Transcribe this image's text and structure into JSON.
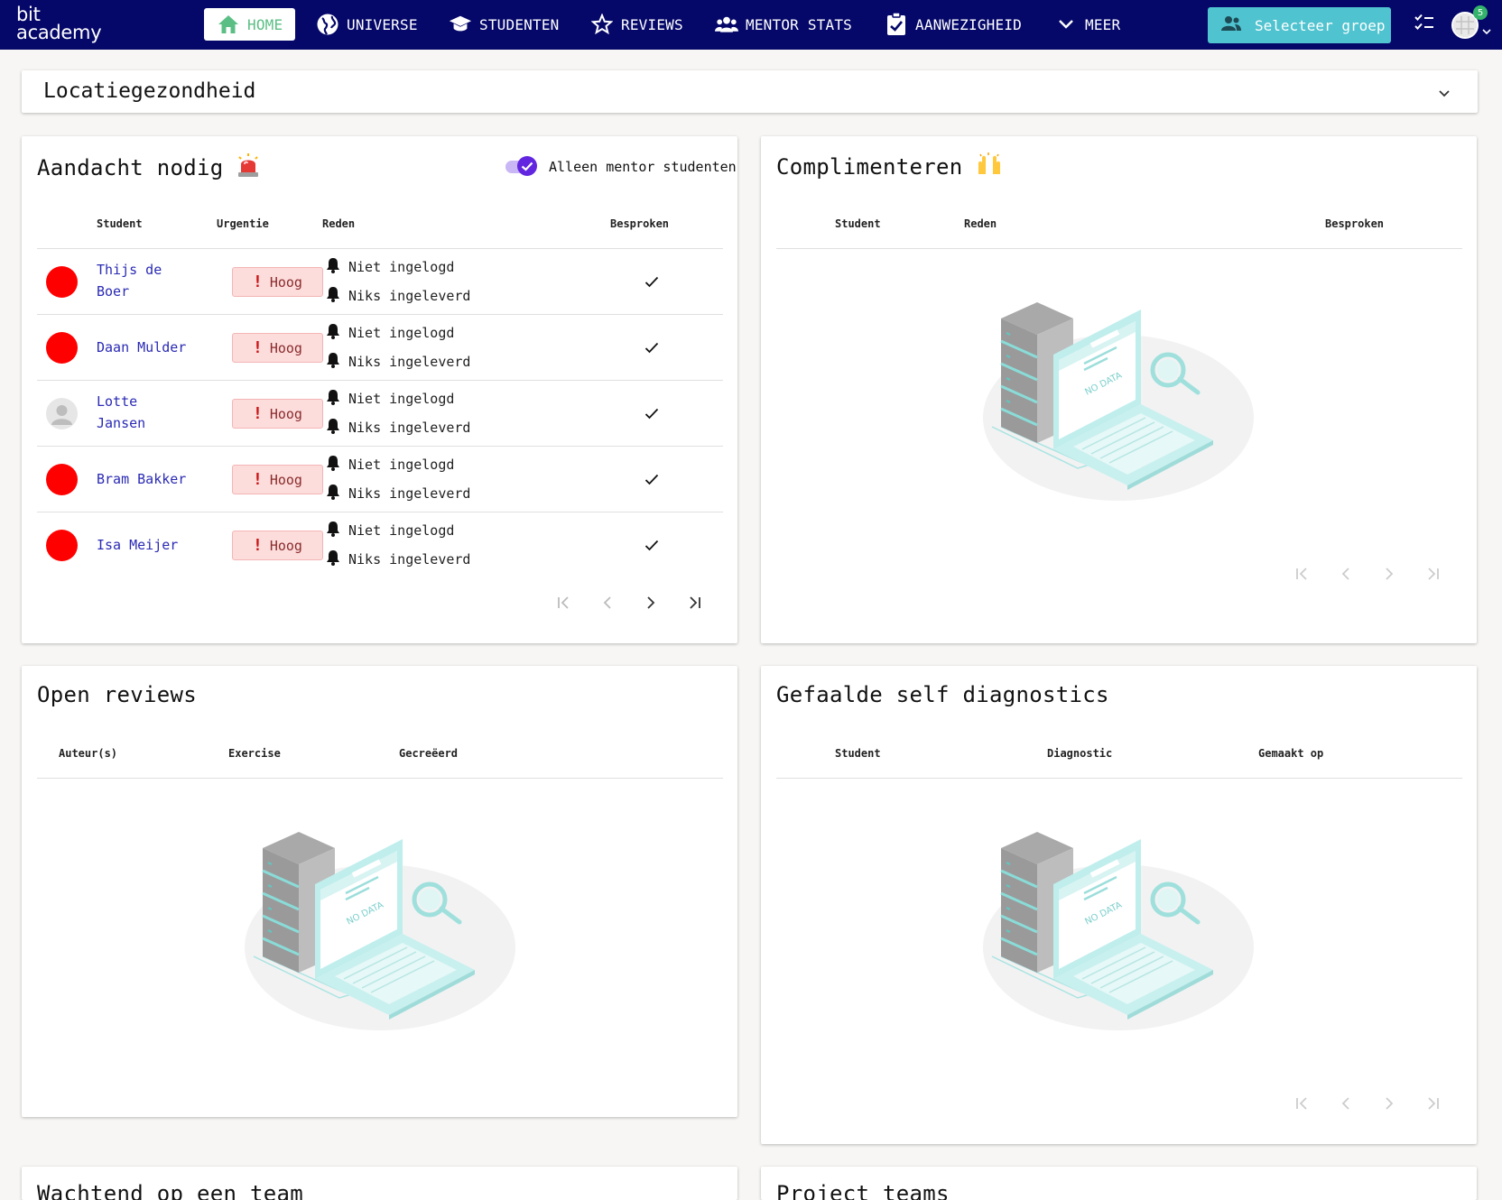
{
  "nav": {
    "logo_line1": "bit",
    "logo_line2": "academy",
    "items": [
      {
        "label": "HOME",
        "icon": "home-icon",
        "active": true
      },
      {
        "label": "UNIVERSE",
        "icon": "globe-icon"
      },
      {
        "label": "STUDENTEN",
        "icon": "graduation-cap-icon"
      },
      {
        "label": "REVIEWS",
        "icon": "star-icon"
      },
      {
        "label": "MENTOR STATS",
        "icon": "users-icon"
      },
      {
        "label": "AANWEZIGHEID",
        "icon": "clipboard-check-icon"
      },
      {
        "label": "MEER",
        "icon": "chevron-down-icon"
      }
    ],
    "select_group": "Selecteer groep",
    "badge_count": "5"
  },
  "colors": {
    "nav_bg": "#050869",
    "accent_teal": "#4fc3cf",
    "link": "#2a2ab5",
    "urgent_red": "#ff0000",
    "toggle": "#6226e0",
    "home_green": "#5bbf85"
  },
  "location_health": {
    "title": "Locatiegezondheid"
  },
  "attention": {
    "title": "Aandacht nodig",
    "toggle_label": "Alleen mentor studenten",
    "toggle_checked": true,
    "columns": [
      "Student",
      "Urgentie",
      "Reden",
      "Besproken"
    ],
    "rows": [
      {
        "name": "Thijs de Boer",
        "line1": "Thijs de",
        "line2": "Boer",
        "urgency": "Hoog",
        "reasons": [
          "Niet ingelogd",
          "Niks ingeleverd"
        ],
        "discussed": true
      },
      {
        "name": "Daan Mulder",
        "line1": "Daan Mulder",
        "line2": "",
        "urgency": "Hoog",
        "reasons": [
          "Niet ingelogd",
          "Niks ingeleverd"
        ],
        "discussed": true
      },
      {
        "name": "Lotte Jansen",
        "line1": "Lotte",
        "line2": "Jansen",
        "urgency": "Hoog",
        "reasons": [
          "Niet ingelogd",
          "Niks ingeleverd"
        ],
        "discussed": true
      },
      {
        "name": "Bram Bakker",
        "line1": "Bram Bakker",
        "line2": "",
        "urgency": "Hoog",
        "reasons": [
          "Niet ingelogd",
          "Niks ingeleverd"
        ],
        "discussed": true
      },
      {
        "name": "Isa Meijer",
        "line1": "Isa Meijer",
        "line2": "",
        "urgency": "Hoog",
        "reasons": [
          "Niet ingelogd",
          "Niks ingeleverd"
        ],
        "discussed": true
      }
    ]
  },
  "compliments": {
    "title": "Complimenteren",
    "columns": [
      "Student",
      "Reden",
      "Besproken"
    ],
    "empty_text": "NO DATA"
  },
  "open_reviews": {
    "title": "Open reviews",
    "columns": [
      "Auteur(s)",
      "Exercise",
      "Gecreëerd"
    ],
    "empty_text": "NO DATA"
  },
  "self_diagnostics": {
    "title": "Gefaalde self diagnostics",
    "columns": [
      "Student",
      "Diagnostic",
      "Gemaakt op"
    ],
    "empty_text": "NO DATA"
  },
  "waiting_team": {
    "title": "Wachtend op een team"
  },
  "project_teams": {
    "title": "Project teams"
  }
}
